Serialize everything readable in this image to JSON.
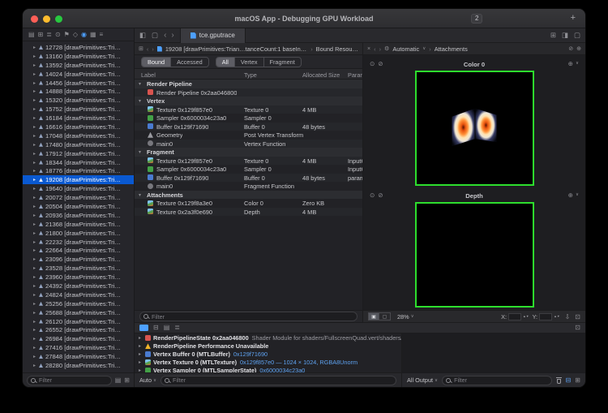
{
  "window": {
    "title": "macOS App - Debugging GPU Workload",
    "badge": "2"
  },
  "sidebar": {
    "nav_icons": [
      "project",
      "changes",
      "symbols",
      "find",
      "issues",
      "tests",
      "debug",
      "breakpoints",
      "reports"
    ],
    "active_nav": "debug",
    "item_suffix": "[drawPrimitives:Tri…",
    "selected_index": 15,
    "items": [
      "12728",
      "13160",
      "13592",
      "14024",
      "14456",
      "14888",
      "15320",
      "15752",
      "16184",
      "16616",
      "17048",
      "17480",
      "17912",
      "18344",
      "18776",
      "19208",
      "19640",
      "20072",
      "20504",
      "20936",
      "21368",
      "21800",
      "22232",
      "22664",
      "23096",
      "23528",
      "23960",
      "24392",
      "24824",
      "25256",
      "25688",
      "26120",
      "26552",
      "26984",
      "27416",
      "27848",
      "28280"
    ],
    "filter_placeholder": "Filter"
  },
  "tabbar": {
    "tab_label": "tce.gputrace"
  },
  "jumpbar": {
    "left_segments": [
      "19208 [drawPrimitives:Trian…tanceCount:1 baseInstance:0]",
      "Bound Resources"
    ],
    "right_segments": [
      "Automatic",
      "Attachments"
    ]
  },
  "resources": {
    "scope_tabs": [
      "Bound",
      "Accessed"
    ],
    "scope_active": "Bound",
    "stage_tabs": [
      "All",
      "Vertex",
      "Fragment"
    ],
    "stage_active": "All",
    "columns": [
      "Label",
      "Type",
      "Allocated Size",
      "Parame"
    ],
    "groups": [
      {
        "name": "Render Pipeline",
        "rows": [
          {
            "icon": "pipeline",
            "label": "Render Pipeline 0x2aa046800",
            "type": "",
            "size": "",
            "param": ""
          }
        ]
      },
      {
        "name": "Vertex",
        "rows": [
          {
            "icon": "texture",
            "label": "Texture 0x129f857e0",
            "type": "Texture 0",
            "size": "4 MB",
            "param": ""
          },
          {
            "icon": "sampler",
            "label": "Sampler 0x6000034c23a0",
            "type": "Sampler 0",
            "size": "",
            "param": ""
          },
          {
            "icon": "buffer",
            "label": "Buffer 0x129f71690",
            "type": "Buffer 0",
            "size": "48 bytes",
            "param": ""
          },
          {
            "icon": "geometry",
            "label": "Geometry",
            "type": "Post Vertex Transform",
            "size": "",
            "param": ""
          },
          {
            "icon": "function",
            "label": "main0",
            "type": "Vertex Function",
            "size": "",
            "param": ""
          }
        ]
      },
      {
        "name": "Fragment",
        "rows": [
          {
            "icon": "texture",
            "label": "Texture 0x129f857e0",
            "type": "Texture 0",
            "size": "4 MB",
            "param": "InputC…"
          },
          {
            "icon": "sampler",
            "label": "Sampler 0x6000034c23a0",
            "type": "Sampler 0",
            "size": "",
            "param": "InputC…"
          },
          {
            "icon": "buffer",
            "label": "Buffer 0x129f71690",
            "type": "Buffer 0",
            "size": "48 bytes",
            "param": "params"
          },
          {
            "icon": "function",
            "label": "main0",
            "type": "Fragment Function",
            "size": "",
            "param": ""
          }
        ]
      },
      {
        "name": "Attachments",
        "rows": [
          {
            "icon": "texture",
            "label": "Texture 0x129f8a3e0",
            "type": "Color 0",
            "size": "Zero KB",
            "param": ""
          },
          {
            "icon": "texture",
            "label": "Texture 0x2a3f0e690",
            "type": "Depth",
            "size": "4 MB",
            "param": ""
          }
        ]
      }
    ],
    "filter_placeholder": "Filter"
  },
  "attachments": {
    "panes": [
      {
        "title": "Color 0"
      },
      {
        "title": "Depth"
      }
    ],
    "border_color": "#2dde2d",
    "zoom": "28%",
    "x_label": "X:",
    "y_label": "Y:"
  },
  "debug": {
    "rows": [
      {
        "icon": "pipeline",
        "title": "RenderPipelineState 0x2aa046800",
        "detail": "Shader Module for shaders/FullscreenQuad.vert/shaders/FullscreenQuad.vert.spv -…",
        "detail_style": "muted"
      },
      {
        "icon": "warning",
        "title": "RenderPipeline Performance Unavailable",
        "detail": "",
        "detail_style": "muted"
      },
      {
        "icon": "buffer",
        "title": "Vertex Buffer 0 (MTLBuffer)",
        "detail": "0x129f71690",
        "detail_style": "link"
      },
      {
        "icon": "texture",
        "title": "Vertex Texture 0 (MTLTexture)",
        "detail": "0x129f857e0 — 1024 × 1024, RGBA8Unorm",
        "detail_style": "link"
      },
      {
        "icon": "sampler",
        "title": "Vertex Sampler 0 (MTLSamplerState)",
        "detail": "0x6000034c23a0",
        "detail_style": "link"
      }
    ],
    "scope_label": "Auto",
    "output_label": "All Output",
    "filter_placeholder": "Filter"
  }
}
